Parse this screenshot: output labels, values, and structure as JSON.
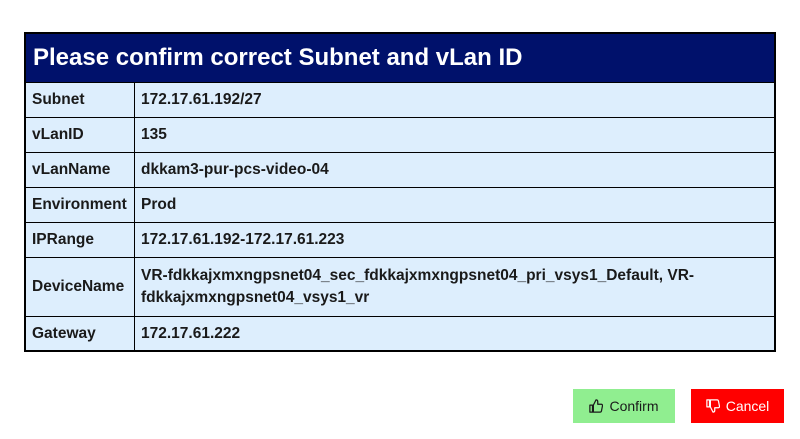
{
  "dialog": {
    "title": "Please confirm correct Subnet and vLan ID",
    "rows": [
      {
        "key": "Subnet",
        "value": "172.17.61.192/27"
      },
      {
        "key": "vLanID",
        "value": "135"
      },
      {
        "key": "vLanName",
        "value": "dkkam3-pur-pcs-video-04"
      },
      {
        "key": "Environment",
        "value": "Prod"
      },
      {
        "key": "IPRange",
        "value": "172.17.61.192-172.17.61.223"
      },
      {
        "key": "DeviceName",
        "value": "VR-fdkkajxmxngpsnet04_sec_fdkkajxmxngpsnet04_pri_vsys1_Default, VR-fdkkajxmxngpsnet04_vsys1_vr"
      },
      {
        "key": "Gateway",
        "value": "172.17.61.222"
      }
    ]
  },
  "actions": {
    "confirm_label": "Confirm",
    "confirm_icon": "thumbs-up-icon",
    "confirm_color": "#90ee90",
    "cancel_label": "Cancel",
    "cancel_icon": "thumbs-down-icon",
    "cancel_color": "#ff0000"
  },
  "colors": {
    "header_bg": "#00116b",
    "table_bg": "#ddeefd"
  }
}
